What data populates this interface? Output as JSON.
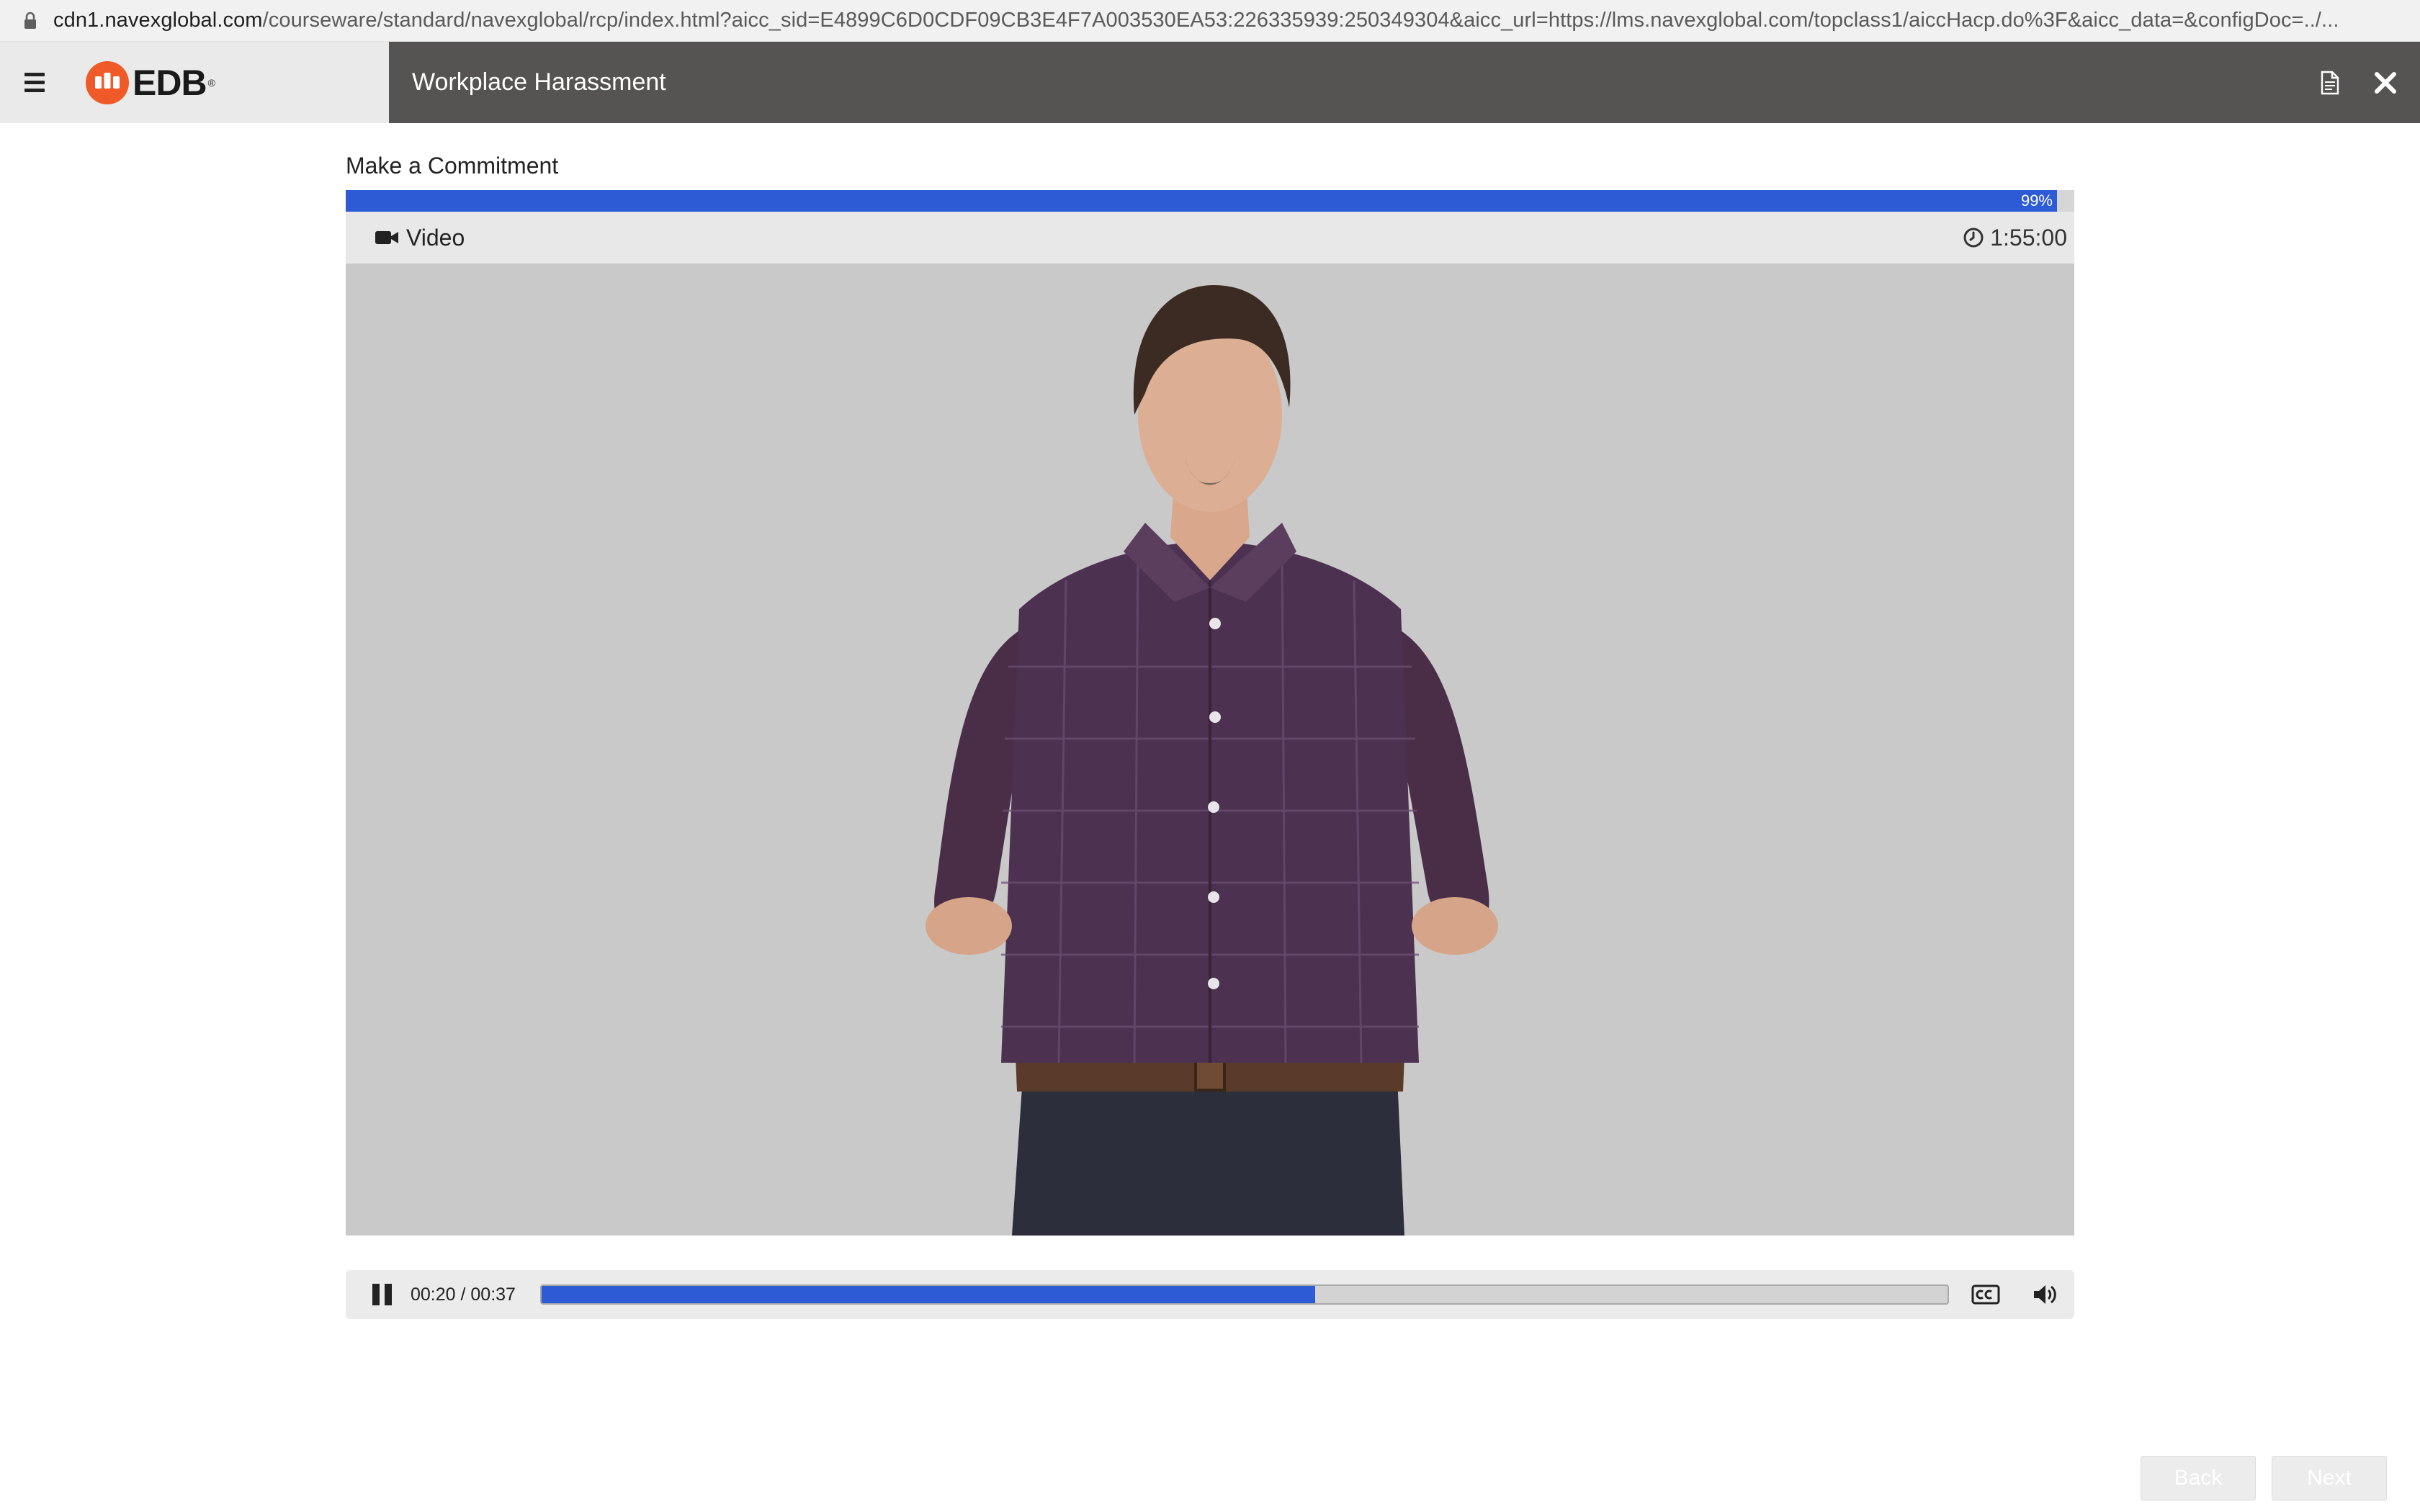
{
  "browser": {
    "url_host": "cdn1.navexglobal.com",
    "url_rest": "/courseware/standard/navexglobal/rcp/index.html?aicc_sid=E4899C6D0CDF09CB3E4F7A003530EA53:226335939:250349304&aicc_url=https://lms.navexglobal.com/topclass1/aiccHacp.do%3F&aicc_data=&configDoc=../..."
  },
  "header": {
    "logo_text": "EDB",
    "logo_tm": "®",
    "course_title": "Workplace Harassment"
  },
  "section": {
    "title": "Make a Commitment",
    "progress_percent": 99,
    "progress_label": "99%"
  },
  "media": {
    "type_label": "Video",
    "duration": "1:55:00"
  },
  "player": {
    "time": "00:20 / 00:37",
    "played_fraction": 0.55
  },
  "nav": {
    "back_label": "Back",
    "next_label": "Next"
  },
  "colors": {
    "accent": "#2d5bd6",
    "header_dark": "#555453",
    "logo_orange": "#f05a28"
  }
}
